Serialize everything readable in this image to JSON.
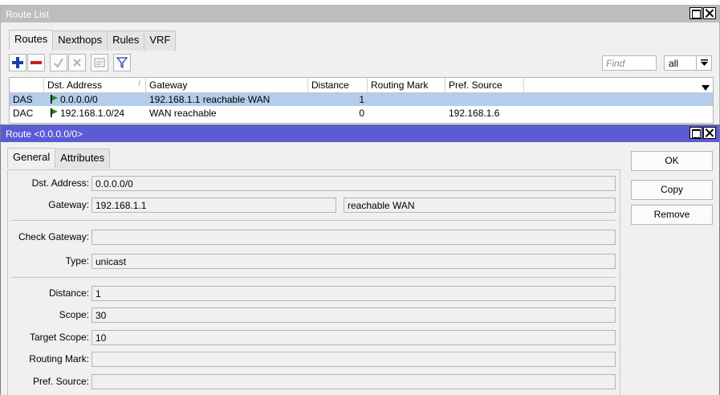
{
  "route_list": {
    "title": "Route List",
    "tabs": [
      "Routes",
      "Nexthops",
      "Rules",
      "VRF"
    ],
    "toolbar": {
      "add_icon": "plus-icon",
      "remove_icon": "minus-icon",
      "enable_icon": "check-icon",
      "disable_icon": "cross-icon",
      "comment_icon": "comment-icon",
      "filter_icon": "filter-icon",
      "find_placeholder": "Find",
      "filter_value": "all"
    },
    "columns": [
      "",
      "Dst. Address",
      "Gateway",
      "Distance",
      "Routing Mark",
      "Pref. Source"
    ],
    "rows": [
      {
        "flags": "DAS",
        "dst": "0.0.0.0/0",
        "gateway": "192.168.1.1 reachable WAN",
        "distance": "1",
        "mark": "",
        "pref": "",
        "selected": true
      },
      {
        "flags": "DAC",
        "dst": "192.168.1.0/24",
        "gateway": "WAN reachable",
        "distance": "0",
        "mark": "",
        "pref": "192.168.1.6",
        "selected": false
      }
    ],
    "colors": {
      "selected_row": "#b4cdea",
      "active_flag": "#1f8b1f"
    }
  },
  "route_dialog": {
    "title": "Route <0.0.0.0/0>",
    "tabs": [
      "General",
      "Attributes"
    ],
    "fields": {
      "dst_address": {
        "label": "Dst. Address:",
        "value": "0.0.0.0/0"
      },
      "gateway": {
        "label": "Gateway:",
        "value": "192.168.1.1",
        "status": "reachable WAN"
      },
      "check_gateway": {
        "label": "Check Gateway:",
        "value": ""
      },
      "type": {
        "label": "Type:",
        "value": "unicast"
      },
      "distance": {
        "label": "Distance:",
        "value": "1"
      },
      "scope": {
        "label": "Scope:",
        "value": "30"
      },
      "target_scope": {
        "label": "Target Scope:",
        "value": "10"
      },
      "routing_mark": {
        "label": "Routing Mark:",
        "value": ""
      },
      "pref_source": {
        "label": "Pref. Source:",
        "value": ""
      }
    },
    "buttons": {
      "ok": "OK",
      "copy": "Copy",
      "remove": "Remove"
    },
    "title_color": "#5b5bd6"
  }
}
